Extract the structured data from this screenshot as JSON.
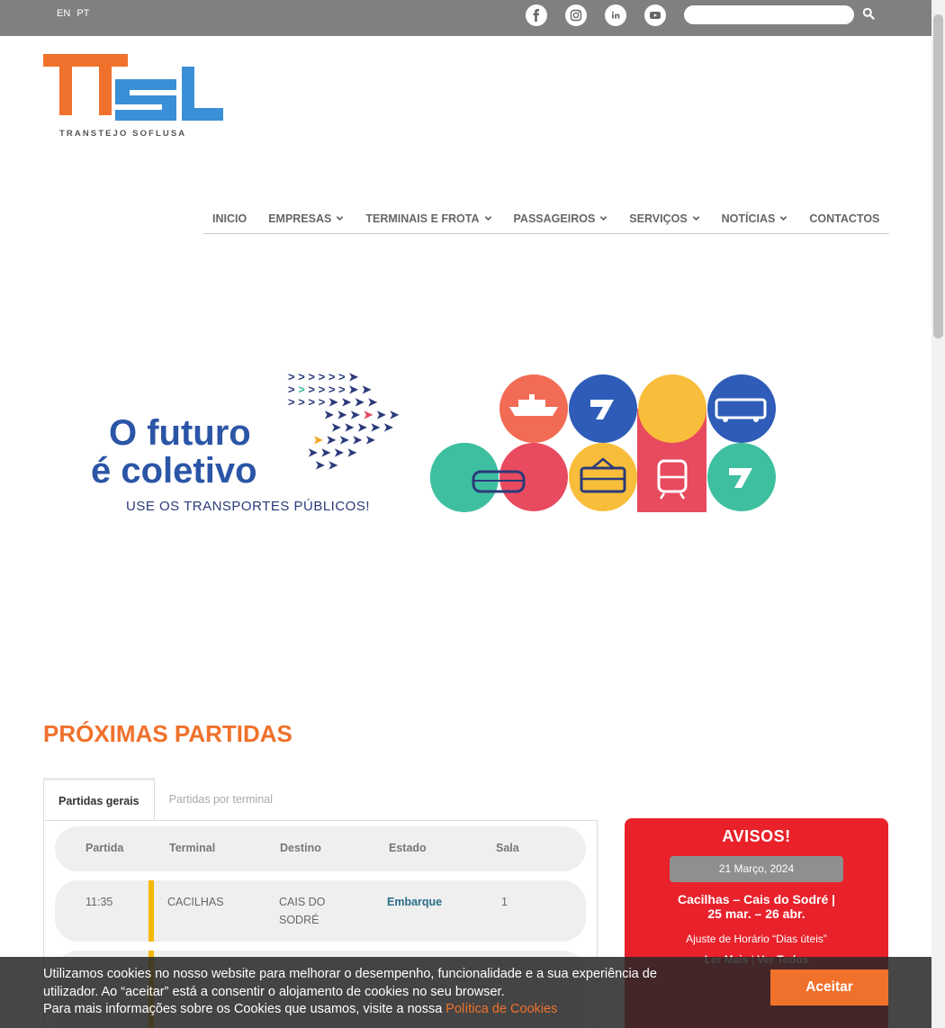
{
  "topbar": {
    "languages": [
      "EN",
      "PT"
    ],
    "social_icons": [
      "facebook-icon",
      "instagram-icon",
      "linkedin-icon",
      "youtube-icon"
    ],
    "search_placeholder": ""
  },
  "logo": {
    "letters": "TTSL",
    "subtitle": "TRANSTEJO SOFLUSA"
  },
  "nav": {
    "items": [
      {
        "label": "INICIO",
        "dropdown": false
      },
      {
        "label": "EMPRESAS",
        "dropdown": true
      },
      {
        "label": "TERMINAIS E FROTA",
        "dropdown": true
      },
      {
        "label": "PASSAGEIROS",
        "dropdown": true
      },
      {
        "label": "SERVIÇOS",
        "dropdown": true
      },
      {
        "label": "NOTÍCIAS",
        "dropdown": true
      },
      {
        "label": "CONTACTOS",
        "dropdown": false
      }
    ]
  },
  "banner": {
    "line1": "O futuro",
    "line2": "é coletivo",
    "tagline": "USE OS TRANSPORTES PÚBLICOS!"
  },
  "departures": {
    "title": "PRÓXIMAS PARTIDAS",
    "tabs": [
      "Partidas gerais",
      "Partidas por terminal"
    ],
    "columns": [
      "Partida",
      "Terminal",
      "Destino",
      "Estado",
      "Sala"
    ],
    "rows": [
      {
        "time": "11:35",
        "terminal": "CACILHAS",
        "destination_1": "CAIS DO",
        "destination_2": "SODRÉ",
        "status": "Embarque",
        "room": "1"
      }
    ]
  },
  "notice": {
    "title": "AVISOS!",
    "date": "21 Março, 2024",
    "headline_1": "Cacilhas – Cais do Sodré |",
    "headline_2": "25 mar. – 26 abr.",
    "body": "Ajuste de Horário “Dias úteis”",
    "read_more": "Ler Mais",
    "separator": "|",
    "view_all": "Ver Todos"
  },
  "cookie": {
    "line1": "Utilizamos cookies no nosso website para melhorar o desempenho, funcionalidade e a sua experiência de",
    "line2": "utilizador. Ao “aceitar” está a consentir o alojamento de cookies no seu browser.",
    "line3": "Para mais informações sobre os Cookies que usamos, visite a nossa ",
    "link": "Política de Cookies",
    "accept": "Aceitar"
  },
  "colors": {
    "brand_orange": "#f0712c",
    "brand_blue": "#3a8fd6",
    "notice_red": "#e8212b",
    "line_yellow": "#f5b800",
    "topbar_grey": "#808080"
  }
}
